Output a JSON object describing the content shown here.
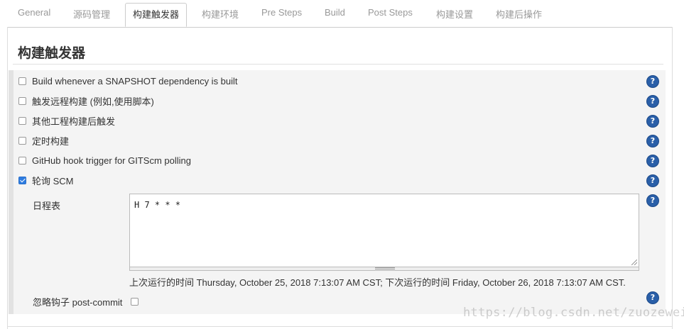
{
  "tabs": [
    {
      "label": "General",
      "active": false
    },
    {
      "label": "源码管理",
      "active": false
    },
    {
      "label": "构建触发器",
      "active": true
    },
    {
      "label": "构建环境",
      "active": false
    },
    {
      "label": "Pre Steps",
      "active": false
    },
    {
      "label": "Build",
      "active": false
    },
    {
      "label": "Post Steps",
      "active": false
    },
    {
      "label": "构建设置",
      "active": false
    },
    {
      "label": "构建后操作",
      "active": false
    }
  ],
  "section": {
    "title": "构建触发器"
  },
  "triggers": [
    {
      "label": "Build whenever a SNAPSHOT dependency is built",
      "checked": false
    },
    {
      "label": "触发远程构建 (例如,使用脚本)",
      "checked": false
    },
    {
      "label": "其他工程构建后触发",
      "checked": false
    },
    {
      "label": "定时构建",
      "checked": false
    },
    {
      "label": "GitHub hook trigger for GITScm polling",
      "checked": false
    },
    {
      "label": "轮询 SCM",
      "checked": true
    }
  ],
  "schedule": {
    "label": "日程表",
    "value": "H 7 * * *",
    "run_info": "上次运行的时间 Thursday, October 25, 2018 7:13:07 AM CST; 下次运行的时间 Friday, October 26, 2018 7:13:07 AM CST."
  },
  "ignore_post_commit": {
    "label": "忽略钩子 post-commit",
    "checked": false
  },
  "help_icon_glyph": "?",
  "watermark": "https://blog.csdn.net/zuozewei",
  "colors": {
    "accent": "#2e7ce0",
    "help": "#2a5fa8",
    "panel": "#f4f4f4"
  }
}
